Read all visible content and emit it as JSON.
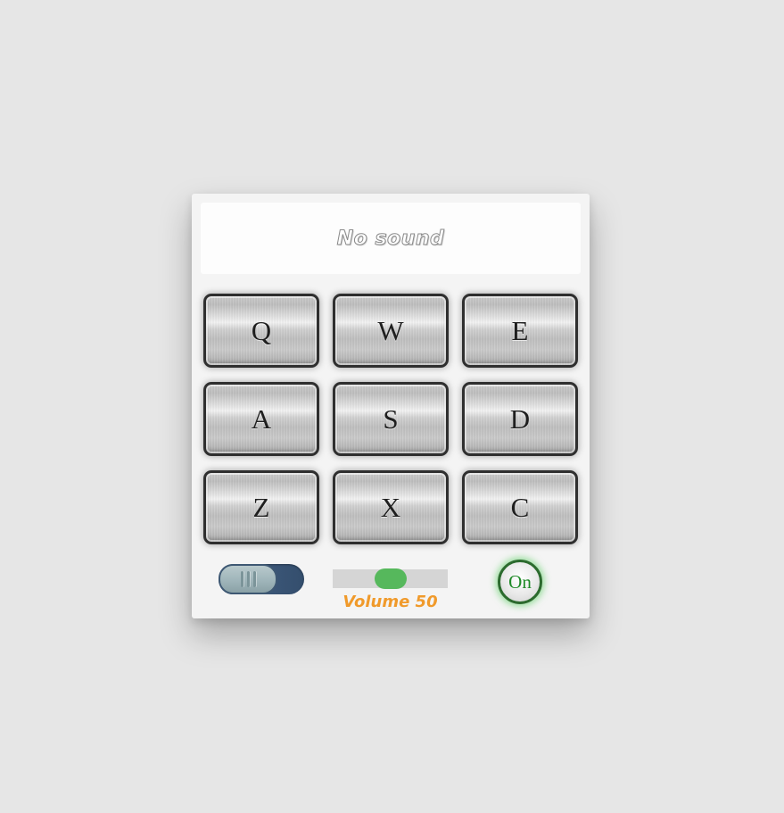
{
  "display": {
    "text": "No sound"
  },
  "pads": [
    {
      "label": "Q"
    },
    {
      "label": "W"
    },
    {
      "label": "E"
    },
    {
      "label": "A"
    },
    {
      "label": "S"
    },
    {
      "label": "D"
    },
    {
      "label": "Z"
    },
    {
      "label": "X"
    },
    {
      "label": "C"
    }
  ],
  "controls": {
    "bank_toggle": {
      "state": "off"
    },
    "volume": {
      "value": 50,
      "min": 0,
      "max": 100,
      "label": "Volume 50"
    },
    "power": {
      "label": "On",
      "state": "on"
    }
  },
  "colors": {
    "background": "#e6e6e6",
    "panel": "#f4f4f4",
    "slider_thumb": "#56b85c",
    "volume_text": "#f09a2b",
    "power_text": "#1f8a27",
    "toggle_track": "#3b5677"
  }
}
